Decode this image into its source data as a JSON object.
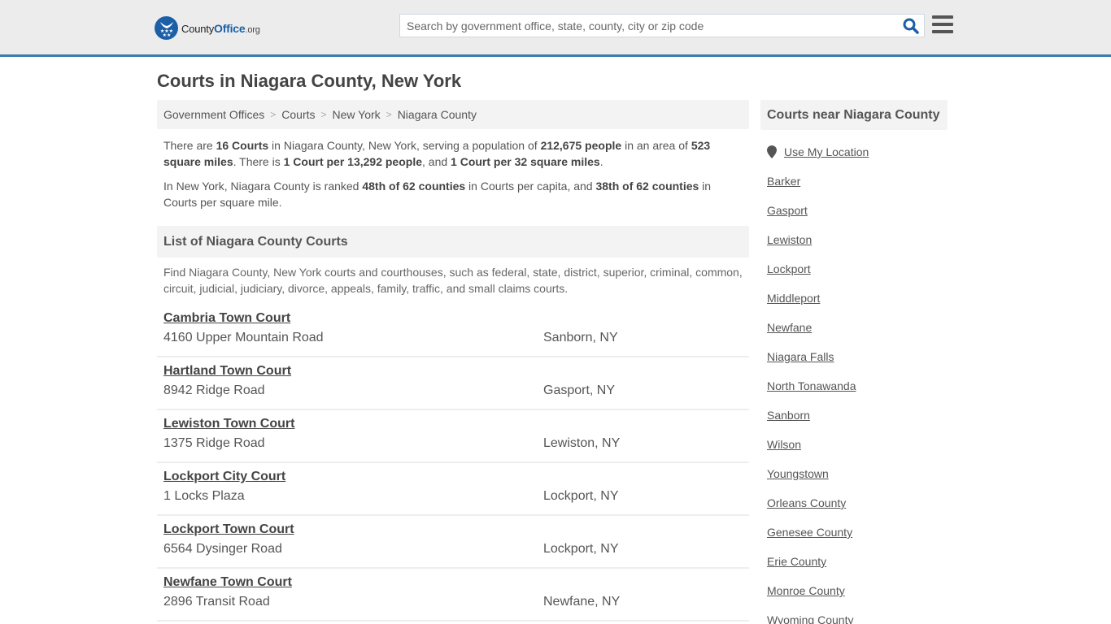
{
  "header": {
    "logo": {
      "text_main": "County",
      "text_accent": "Office",
      "text_suffix": ".org"
    },
    "search": {
      "placeholder": "Search by government office, state, county, city or zip code",
      "value": ""
    },
    "icons": {
      "search": "search-icon",
      "menu": "hamburger-menu-icon",
      "logo": "eagle-stars-logo-icon"
    }
  },
  "page": {
    "title": "Courts in Niagara County, New York",
    "breadcrumb": [
      "Government Offices",
      "Courts",
      "New York",
      "Niagara County"
    ],
    "intro": {
      "p1": [
        {
          "t": "There are ",
          "b": false
        },
        {
          "t": "16 Courts",
          "b": true
        },
        {
          "t": " in Niagara County, New York, serving a population of ",
          "b": false
        },
        {
          "t": "212,675 people",
          "b": true
        },
        {
          "t": " in an area of ",
          "b": false
        },
        {
          "t": "523 square miles",
          "b": true
        },
        {
          "t": ". There is ",
          "b": false
        },
        {
          "t": "1 Court per 13,292 people",
          "b": true
        },
        {
          "t": ", and ",
          "b": false
        },
        {
          "t": "1 Court per 32 square miles",
          "b": true
        },
        {
          "t": ".",
          "b": false
        }
      ],
      "p2": [
        {
          "t": "In New York, Niagara County is ranked ",
          "b": false
        },
        {
          "t": "48th of 62 counties",
          "b": true
        },
        {
          "t": " in Courts per capita, and ",
          "b": false
        },
        {
          "t": "38th of 62 counties",
          "b": true
        },
        {
          "t": " in Courts per square mile.",
          "b": false
        }
      ]
    },
    "list_heading": "List of Niagara County Courts",
    "list_description": "Find Niagara County, New York courts and courthouses, such as federal, state, district, superior, criminal, common, circuit, judicial, judiciary, divorce, appeals, family, traffic, and small claims courts.",
    "courts": [
      {
        "name": "Cambria Town Court",
        "address": "4160 Upper Mountain Road",
        "city": "Sanborn, NY"
      },
      {
        "name": "Hartland Town Court",
        "address": "8942 Ridge Road",
        "city": "Gasport, NY"
      },
      {
        "name": "Lewiston Town Court",
        "address": "1375 Ridge Road",
        "city": "Lewiston, NY"
      },
      {
        "name": "Lockport City Court",
        "address": "1 Locks Plaza",
        "city": "Lockport, NY"
      },
      {
        "name": "Lockport Town Court",
        "address": "6564 Dysinger Road",
        "city": "Lockport, NY"
      },
      {
        "name": "Newfane Town Court",
        "address": "2896 Transit Road",
        "city": "Newfane, NY"
      }
    ]
  },
  "sidebar": {
    "heading": "Courts near Niagara County",
    "use_location": "Use My Location",
    "links": [
      "Barker",
      "Gasport",
      "Lewiston",
      "Lockport",
      "Middleport",
      "Newfane",
      "Niagara Falls",
      "North Tonawanda",
      "Sanborn",
      "Wilson",
      "Youngstown",
      "Orleans County",
      "Genesee County",
      "Erie County",
      "Monroe County",
      "Wyoming County"
    ]
  },
  "colors": {
    "brand_blue": "#1c5fa8",
    "accent_line": "#3a7bb0",
    "header_bg": "#ececec",
    "panel_bg": "#f3f3f3",
    "text": "#555555"
  }
}
